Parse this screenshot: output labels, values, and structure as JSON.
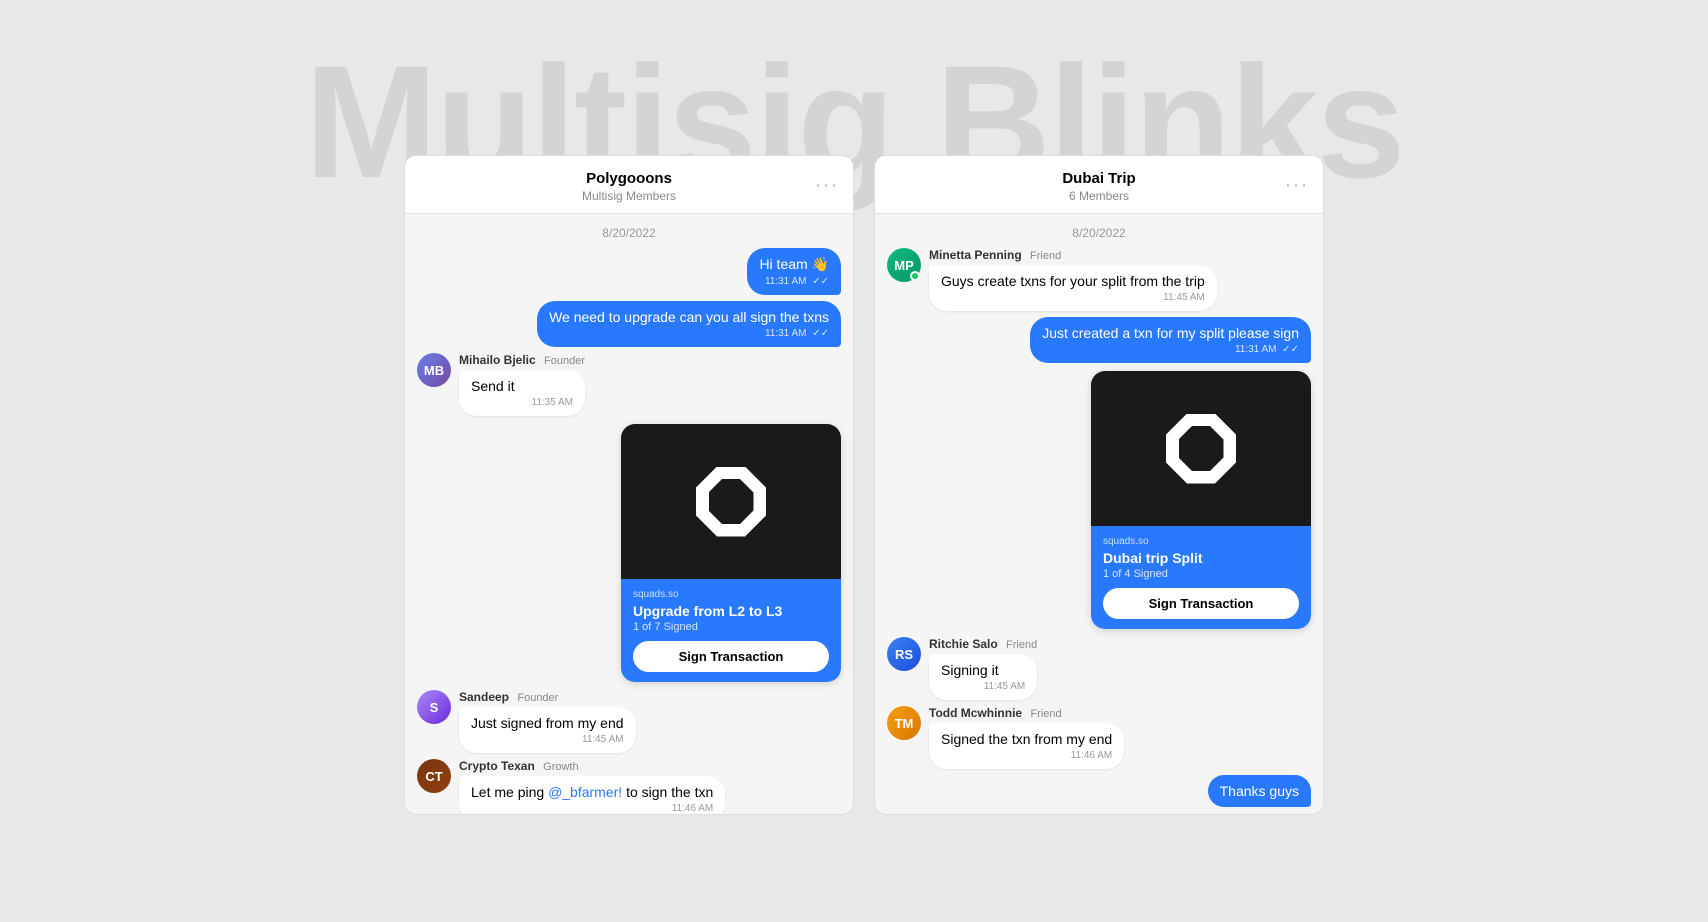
{
  "bg_title": "Multisig Blinks",
  "panels": [
    {
      "id": "polygooons",
      "header": {
        "title": "Polygooons",
        "subtitle": "Multisig Members",
        "menu_label": "···"
      },
      "date_separator": "8/20/2022",
      "messages": [
        {
          "type": "out",
          "text": "Hi team 👋",
          "time": "11:31 AM",
          "double_check": true
        },
        {
          "type": "out",
          "text": "We need to upgrade can you all sign the txns",
          "time": "11:31 AM",
          "double_check": true
        },
        {
          "type": "in",
          "sender": "Mihailo Bjelic",
          "badge": "Founder",
          "avatar_class": "av-img-mihailo",
          "avatar_initials": "MB",
          "text": "Send it",
          "time": "11:35 AM"
        },
        {
          "type": "blink",
          "side": "right",
          "domain": "squads.so",
          "title": "Upgrade from L2 to L3",
          "subtitle": "1 of 7 Signed",
          "btn_label": "Sign Transaction"
        },
        {
          "type": "in",
          "sender": "Sandeep",
          "badge": "Founder",
          "avatar_class": "av-img-sandeep",
          "avatar_initials": "S",
          "text": "Just signed from my end",
          "time": "11:45 AM"
        },
        {
          "type": "in",
          "sender": "Crypto Texan",
          "badge": "Growth",
          "avatar_class": "av-img-crypto",
          "avatar_initials": "CT",
          "text": "Let me ping @_bfarmer! to sign the txn",
          "time": "11:46 AM",
          "has_mention": true,
          "mention_text": "@_bfarmer!"
        }
      ]
    },
    {
      "id": "dubai-trip",
      "header": {
        "title": "Dubai Trip",
        "subtitle": "6 Members",
        "menu_label": "···"
      },
      "date_separator": "8/20/2022",
      "messages": [
        {
          "type": "in",
          "sender": "Minetta Penning",
          "badge": "Friend",
          "avatar_class": "av-img-minetta",
          "avatar_initials": "MP",
          "text": "Guys create txns for your split from the trip",
          "time": "11:45 AM",
          "has_online": true
        },
        {
          "type": "out",
          "text": "Just created a txn for my split please sign",
          "time": "11:31 AM",
          "double_check": true
        },
        {
          "type": "blink",
          "side": "right",
          "domain": "squads.so",
          "title": "Dubai trip Split",
          "subtitle": "1 of 4 Signed",
          "btn_label": "Sign Transaction"
        },
        {
          "type": "in",
          "sender": "Ritchie Salo",
          "badge": "Friend",
          "avatar_class": "av-img-ritchie",
          "avatar_initials": "RS",
          "text": "Signing it",
          "time": "11:45 AM"
        },
        {
          "type": "in",
          "sender": "Todd Mcwhinnie",
          "badge": "Friend",
          "avatar_class": "av-img-todd",
          "avatar_initials": "TM",
          "text": "Signed the txn from my end",
          "time": "11:46 AM"
        }
      ]
    }
  ]
}
